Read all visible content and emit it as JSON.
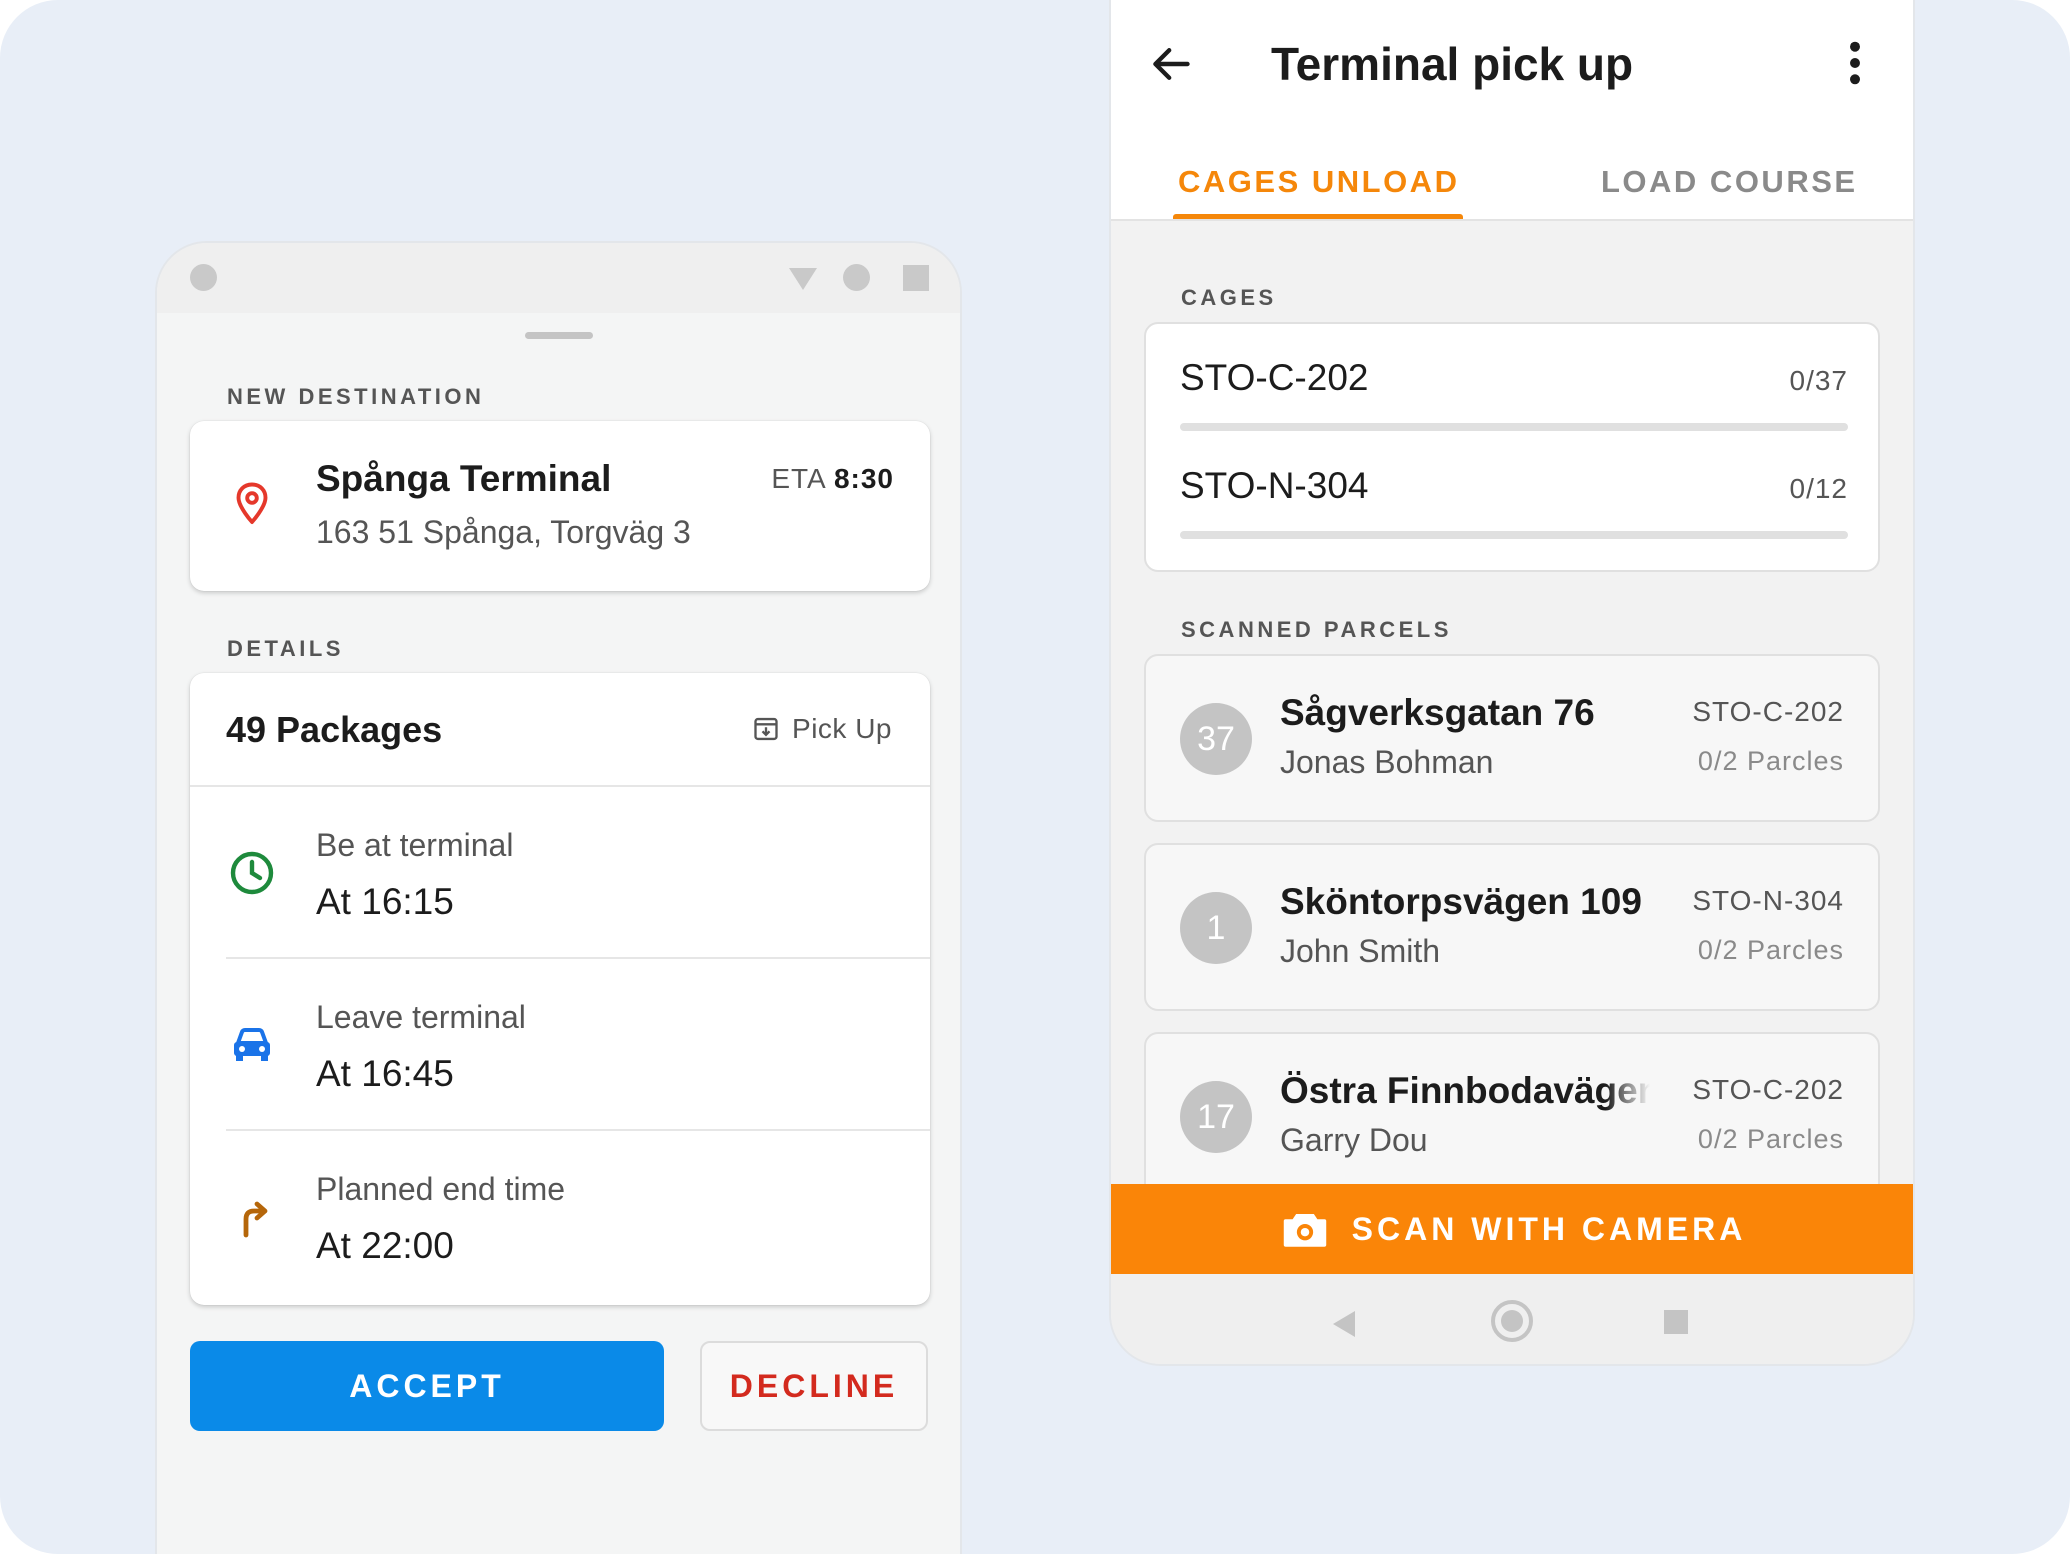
{
  "left_screen": {
    "new_destination_label": "NEW DESTINATION",
    "destination": {
      "name": "Spånga Terminal",
      "address": "163 51 Spånga, Torgväg 3",
      "eta_label": "ETA",
      "eta_time": "8:30",
      "icon": "location-pin-icon",
      "icon_color": "#e5382b"
    },
    "details_label": "DETAILS",
    "packages": "49 Packages",
    "pickup_label": "Pick Up",
    "rows": [
      {
        "label": "Be at terminal",
        "value": "At 16:15",
        "icon": "clock-icon",
        "color": "#1e8a3c"
      },
      {
        "label": "Leave terminal",
        "value": "At 16:45",
        "icon": "car-icon",
        "color": "#1a73e8"
      },
      {
        "label": "Planned end time",
        "value": "At 22:00",
        "icon": "turn-right-arrow-icon",
        "color": "#b5660a"
      }
    ],
    "accept_label": "ACCEPT",
    "decline_label": "DECLINE"
  },
  "right_screen": {
    "title": "Terminal pick up",
    "tabs": [
      {
        "label": "CAGES UNLOAD",
        "active": true
      },
      {
        "label": "LOAD COURSE",
        "active": false
      }
    ],
    "cages_label": "CAGES",
    "cages": [
      {
        "name": "STO-C-202",
        "count": "0/37",
        "progress": 0
      },
      {
        "name": "STO-N-304",
        "count": "0/12",
        "progress": 0
      }
    ],
    "scanned_label": "SCANNED PARCELS",
    "parcels": [
      {
        "number": "37",
        "street": "Sågverksgatan 76",
        "person": "Jonas Bohman",
        "cage": "STO-C-202",
        "parcels": "0/2 Parcles"
      },
      {
        "number": "1",
        "street": "Sköntorpsvägen 109",
        "person": "John Smith",
        "cage": "STO-N-304",
        "parcels": "0/2 Parcles"
      },
      {
        "number": "17",
        "street": "Östra Finnbodavägen",
        "person": "Garry Dou",
        "cage": "STO-C-202",
        "parcels": "0/2 Parcles"
      }
    ],
    "scan_label": "SCAN WITH CAMERA",
    "accent_color": "#f5870a"
  }
}
